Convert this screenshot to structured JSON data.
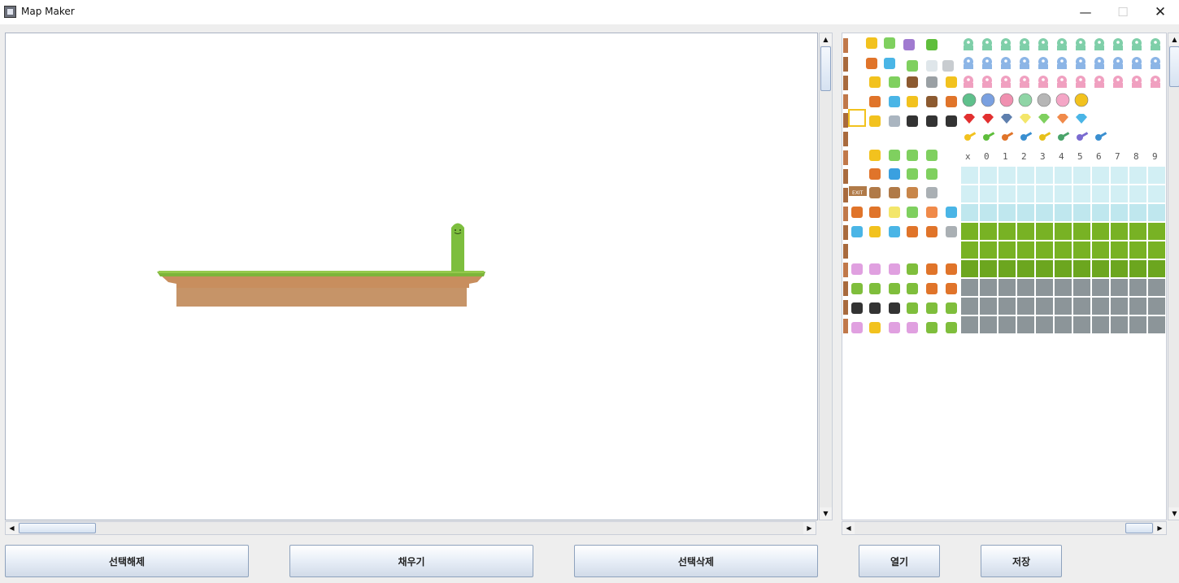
{
  "window": {
    "title": "Map Maker",
    "minimize_glyph": "—",
    "maximize_glyph": "☐",
    "close_glyph": "✕"
  },
  "scroll": {
    "up": "▲",
    "down": "▼",
    "left": "◀",
    "right": "▶"
  },
  "palette": {
    "digits": [
      "x",
      "0",
      "1",
      "2",
      "3",
      "4",
      "5",
      "6",
      "7",
      "8",
      "9"
    ],
    "exit_sign": "EXIT"
  },
  "buttons": {
    "deselect": "선택해제",
    "fill": "채우기",
    "delete_selection": "선택삭제",
    "open": "열기",
    "save": "저장"
  },
  "colors": {
    "grass": "#7db53a",
    "dirt": "#c69468",
    "slime": "#7dbe3e",
    "water": "#cfeef3",
    "stone": "#8c9599"
  }
}
